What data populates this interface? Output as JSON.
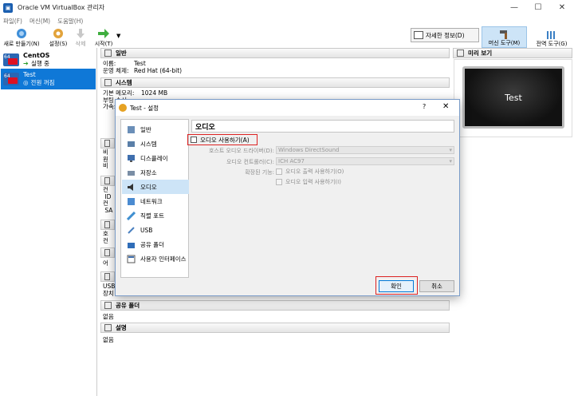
{
  "window": {
    "title": "Oracle VM VirtualBox 관리자"
  },
  "menu": [
    "파일(F)",
    "머신(M)",
    "도움말(H)"
  ],
  "toolbar": {
    "new": "새로 만들기(N)",
    "settings": "설정(S)",
    "delete": "삭제",
    "start": "시작(T)",
    "details": "자세한 정보(D)",
    "machine_tools": "머신 도구(M)",
    "global_tools": "전역 도구(G)"
  },
  "vms": [
    {
      "name": "CentOS",
      "state": "실행 중"
    },
    {
      "name": "Test",
      "state": "전원 꺼짐"
    }
  ],
  "details": {
    "general": {
      "header": "일반",
      "name_k": "이름:",
      "name_v": "Test",
      "os_k": "운영 체제:",
      "os_v": "Red Hat (64-bit)"
    },
    "system": {
      "header": "시스템",
      "mem_k": "기본 메모리:",
      "mem_v": "1024 MB",
      "line2": "부팅 순서:",
      "line3": "가속:"
    },
    "shared": {
      "header": "공유 폴더",
      "value": "없음"
    },
    "desc": {
      "header": "설명",
      "value": "없음"
    },
    "frag": {
      "display": "비\n원\n비",
      "storage": "컨\n ID\n컨\n SA",
      "audio": "호\n컨",
      "network": "어",
      "usb": "USB\n장치"
    }
  },
  "preview": {
    "header": "미리 보기",
    "screen_text": "Test"
  },
  "dialog": {
    "title": "Test - 설정",
    "help": "?",
    "close": "✕",
    "categories": [
      "일반",
      "시스템",
      "디스플레이",
      "저장소",
      "오디오",
      "네트워크",
      "직렬 포트",
      "USB",
      "공유 폴더",
      "사용자 인터페이스"
    ],
    "page_title": "오디오",
    "enable_audio": "오디오 사용하기(A)",
    "host_driver_label": "호스트 오디오 드라이버(D):",
    "host_driver_value": "Windows DirectSound",
    "controller_label": "오디오 컨트롤러(C):",
    "controller_value": "ICH AC97",
    "ext_label": "확장된 기능:",
    "out_label": "오디오 출력 사용하기(O)",
    "in_label": "오디오 입력 사용하기(I)",
    "ok": "확인",
    "cancel": "취소"
  },
  "colors": {
    "selection": "#0f78d7",
    "highlight": "#d22222"
  }
}
